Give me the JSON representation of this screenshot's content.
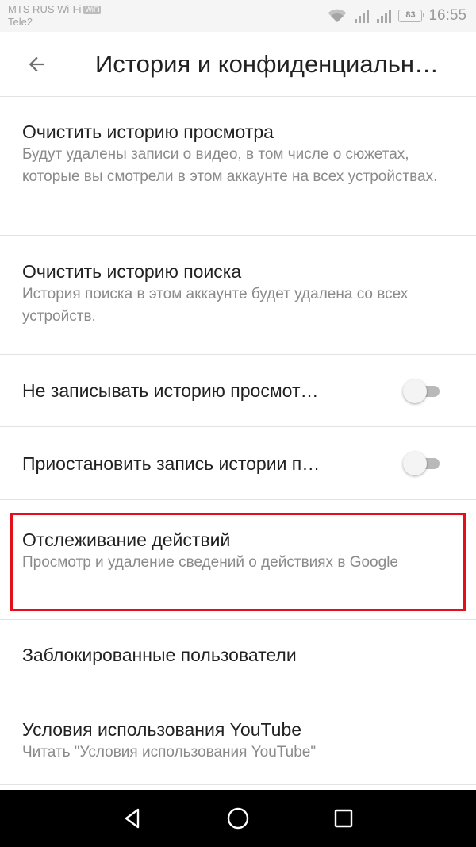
{
  "status_bar": {
    "carrier_primary": "MTS RUS Wi-Fi",
    "wifi_badge": "WiFi",
    "carrier_secondary": "Tele2",
    "battery_level": "83",
    "time": "16:55"
  },
  "app_bar": {
    "title": "История и конфиденциальн…",
    "back_icon": "arrow-back-icon"
  },
  "settings": {
    "items": [
      {
        "title": "Очистить историю просмотра",
        "subtitle": "Будут удалены записи о видео, в том числе о сюжетах, которые вы смотрели в этом аккаунте на всех устройствах."
      },
      {
        "title": "Очистить историю поиска",
        "subtitle": "История поиска в этом аккаунте будет удалена со всех устройств."
      },
      {
        "title": "Не записывать историю просмот…",
        "toggle_on": false
      },
      {
        "title": "Приостановить запись истории п…",
        "toggle_on": false
      },
      {
        "title": "Отслеживание действий",
        "subtitle": "Просмотр и удаление сведений о действиях в Google"
      },
      {
        "title": "Заблокированные пользователи"
      },
      {
        "title": "Условия использования YouTube",
        "subtitle": "Читать \"Условия использования YouTube\""
      }
    ]
  },
  "highlight_color": "#e3101b",
  "nav_bar": {
    "icons": [
      "back-triangle-icon",
      "home-circle-icon",
      "recents-square-icon"
    ]
  }
}
